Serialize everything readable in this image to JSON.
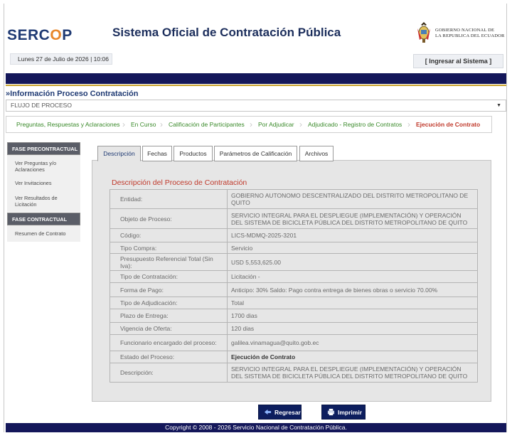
{
  "header": {
    "logo_parts": [
      "SERC",
      "O",
      "P"
    ],
    "title": "Sistema Oficial de Contratación Pública",
    "gov_line1": "GOBIERNO NACIONAL DE",
    "gov_line2": "LA REPUBLICA DEL ECUADOR",
    "date": "Lunes 27 de Julio de 2026 | 10:06",
    "login_label": "[ Ingresar al Sistema ]"
  },
  "section": {
    "title": "»Información Proceso Contratación",
    "flujo": "FLUJO DE PROCESO"
  },
  "breadcrumb": [
    {
      "label": "Preguntas, Respuestas y Aclaraciones",
      "active": false
    },
    {
      "label": "En Curso",
      "active": false
    },
    {
      "label": "Calificación de Participantes",
      "active": false
    },
    {
      "label": "Por Adjudicar",
      "active": false
    },
    {
      "label": "Adjudicado - Registro de Contratos",
      "active": false
    },
    {
      "label": "Ejecución de Contrato",
      "active": true
    }
  ],
  "sidebar": {
    "fase_pre": "FASE PRECONTRACTUAL",
    "pre_items": [
      "Ver Preguntas y/o Aclaraciones",
      "Ver Invitaciones",
      "Ver Resultados de Licitación"
    ],
    "fase_con": "FASE CONTRACTUAL",
    "con_items": [
      "Resumen de Contrato"
    ]
  },
  "tabs": [
    "Descripción",
    "Fechas",
    "Productos",
    "Parámetros de Calificación",
    "Archivos"
  ],
  "description": {
    "title": "Descripción del Proceso de Contratación",
    "rows": [
      {
        "k": "Entidad:",
        "v": "GOBIERNO AUTONOMO DESCENTRALIZADO DEL DISTRITO METROPOLITANO DE QUITO"
      },
      {
        "k": "Objeto de Proceso:",
        "v": "SERVICIO INTEGRAL PARA EL DESPLIEGUE (IMPLEMENTACIÓN) Y OPERACIÓN DEL SISTEMA DE BICICLETA PÚBLICA DEL DISTRITO METROPOLITANO DE QUITO"
      },
      {
        "k": "Código:",
        "v": "LICS-MDMQ-2025-3201"
      },
      {
        "k": "Tipo Compra:",
        "v": "Servicio"
      },
      {
        "k": "Presupuesto Referencial Total (Sin Iva):",
        "v": "USD 5,553,625.00"
      },
      {
        "k": "Tipo de Contratación:",
        "v": "Licitación -"
      },
      {
        "k": "Forma de Pago:",
        "v": "Anticipo: 30% Saldo: Pago contra entrega de bienes obras o servicio 70.00%"
      },
      {
        "k": "Tipo de Adjudicación:",
        "v": "Total"
      },
      {
        "k": "Plazo de Entrega:",
        "v": "1700 dias"
      },
      {
        "k": "Vigencia de Oferta:",
        "v": "120 dias"
      },
      {
        "k": "Funcionario encargado del proceso:",
        "v": "galilea.vinamagua@quito.gob.ec"
      },
      {
        "k": "Estado del Proceso:",
        "v": "Ejecución de Contrato",
        "bold": true
      },
      {
        "k": "Descripción:",
        "v": "SERVICIO INTEGRAL PARA EL DESPLIEGUE (IMPLEMENTACIÓN) Y OPERACIÓN DEL SISTEMA DE BICICLETA PÚBLICA DEL DISTRITO METROPOLITANO DE QUITO"
      }
    ]
  },
  "buttons": {
    "back": "Regresar",
    "print": "Imprimir"
  },
  "footer": "Copyright © 2008 - 2026 Servicio Nacional de Contratación Pública.",
  "colors": {
    "navy": "#14175a",
    "gold": "#c9a22a",
    "accent_red": "#c0392b",
    "crumb_green": "#3a8a2a"
  }
}
